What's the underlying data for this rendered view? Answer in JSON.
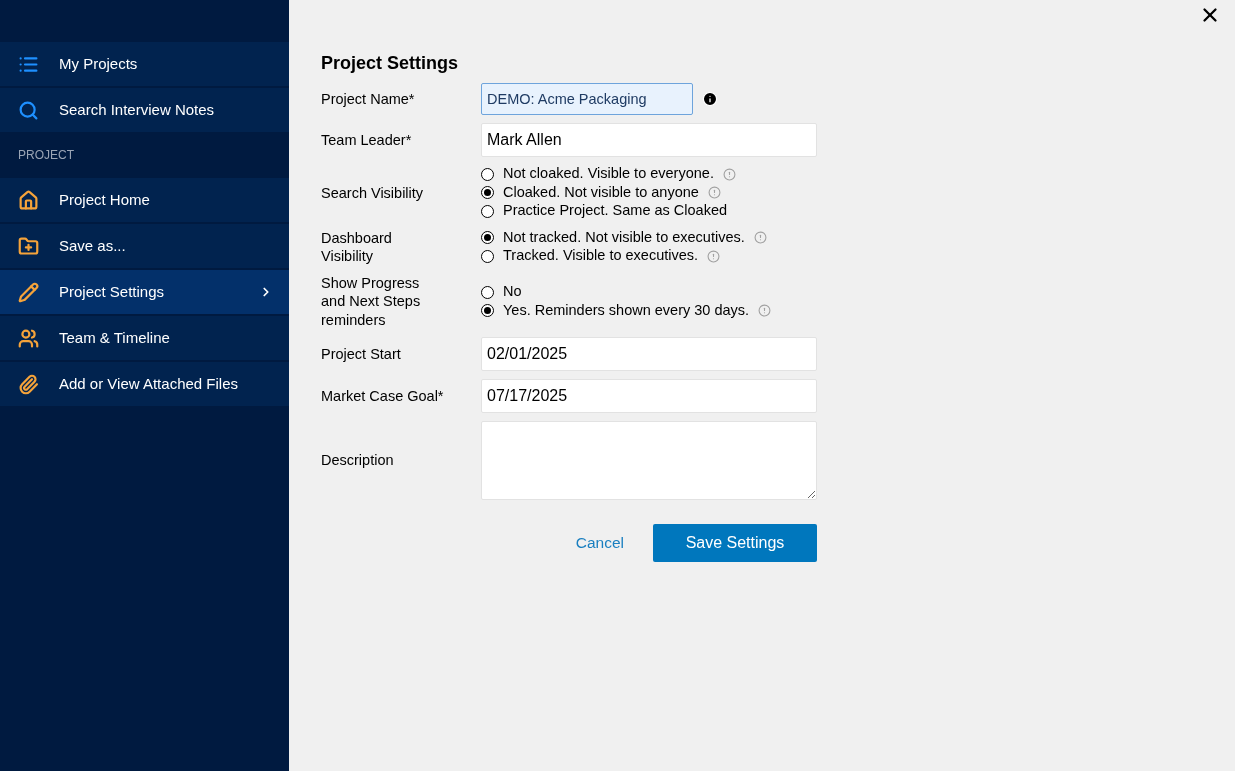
{
  "sidebar": {
    "top_items": [
      {
        "kind": "list",
        "label": "My Projects",
        "selected": false
      },
      {
        "kind": "search",
        "label": "Search Interview Notes",
        "selected": false
      }
    ],
    "section_label": "PROJECT",
    "project_items": [
      {
        "kind": "home",
        "label": "Project Home",
        "selected": false
      },
      {
        "kind": "save",
        "label": "Save as...",
        "selected": false
      },
      {
        "kind": "settings",
        "label": "Project Settings",
        "selected": true
      },
      {
        "kind": "team",
        "label": "Team & Timeline",
        "selected": false
      },
      {
        "kind": "files",
        "label": "Add or View Attached Files",
        "selected": false
      }
    ]
  },
  "form": {
    "title": "Project Settings",
    "fields": [
      {
        "kind": "text",
        "label": "Project Name*",
        "value": "DEMO: Acme Packaging",
        "focused": true,
        "info": true
      },
      {
        "kind": "text",
        "label": "Team Leader*",
        "value": "Mark Allen",
        "focused": false,
        "info": false
      },
      {
        "kind": "radio",
        "label": "Search Visibility",
        "options": [
          {
            "label": "Not cloaked. Visible to everyone.",
            "selected": false,
            "hint": true
          },
          {
            "label": "Cloaked. Not visible to anyone",
            "selected": true,
            "hint": true
          },
          {
            "label": "Practice Project. Same as Cloaked",
            "selected": false,
            "hint": false
          }
        ]
      },
      {
        "kind": "radio",
        "label": "Dashboard Visibility",
        "options": [
          {
            "label": "Not tracked. Not visible to executives.",
            "selected": true,
            "hint": true
          },
          {
            "label": "Tracked. Visible to executives.",
            "selected": false,
            "hint": true
          }
        ]
      },
      {
        "kind": "radio",
        "label": "Show Progress and Next Steps reminders",
        "options": [
          {
            "label": "No",
            "selected": false,
            "hint": false
          },
          {
            "label": "Yes. Reminders shown every 30 days.",
            "selected": true,
            "hint": true
          }
        ]
      },
      {
        "kind": "text",
        "label": "Project Start",
        "value": "02/01/2025",
        "focused": false,
        "info": false
      },
      {
        "kind": "text",
        "label": "Market Case Goal*",
        "value": "07/17/2025",
        "focused": false,
        "info": false
      },
      {
        "kind": "textarea",
        "label": "Description"
      }
    ],
    "cancel": "Cancel",
    "save": "Save Settings"
  }
}
